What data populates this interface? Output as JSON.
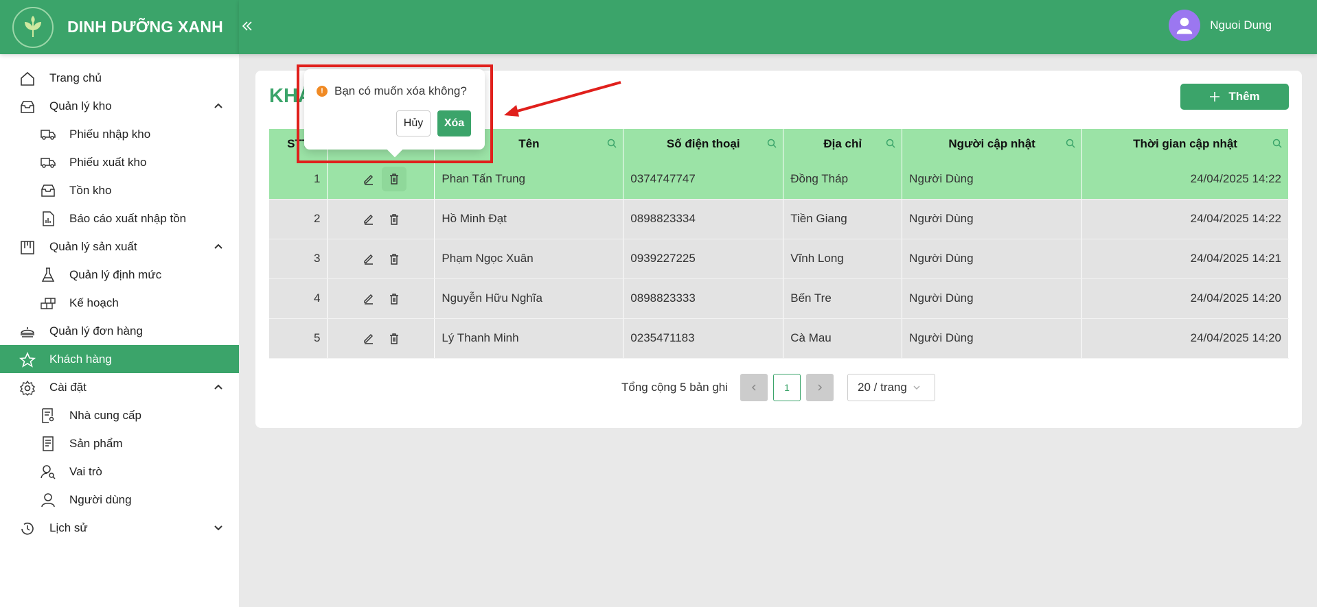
{
  "brand": {
    "title": "DINH DƯỠNG XANH"
  },
  "header": {
    "user_name": "Nguoi Dung"
  },
  "sidebar": {
    "items": [
      {
        "label": "Trang chủ"
      },
      {
        "label": "Quản lý kho"
      },
      {
        "label": "Phiếu nhập kho"
      },
      {
        "label": "Phiếu xuất kho"
      },
      {
        "label": "Tồn kho"
      },
      {
        "label": "Báo cáo xuất nhập tồn"
      },
      {
        "label": "Quản lý sản xuất"
      },
      {
        "label": "Quản lý định mức"
      },
      {
        "label": "Kế hoạch"
      },
      {
        "label": "Quản lý đơn hàng"
      },
      {
        "label": "Khách hàng"
      },
      {
        "label": "Cài đặt"
      },
      {
        "label": "Nhà cung cấp"
      },
      {
        "label": "Sản phẩm"
      },
      {
        "label": "Vai trò"
      },
      {
        "label": "Người dùng"
      },
      {
        "label": "Lịch sử"
      }
    ]
  },
  "page": {
    "title": "KHÁCH HÀNG",
    "add_label": "Thêm"
  },
  "table": {
    "headers": [
      "STT",
      "",
      "Tên",
      "Số điện thoại",
      "Địa chỉ",
      "Người cập nhật",
      "Thời gian cập nhật"
    ],
    "rows": [
      {
        "stt": "1",
        "name": "Phan Tấn Trung",
        "phone": "0374747747",
        "address": "Đồng Tháp",
        "updated_by": "Người Dùng",
        "updated_at": "24/04/2025 14:22"
      },
      {
        "stt": "2",
        "name": "Hồ Minh Đạt",
        "phone": "0898823334",
        "address": "Tiền Giang",
        "updated_by": "Người Dùng",
        "updated_at": "24/04/2025 14:22"
      },
      {
        "stt": "3",
        "name": "Phạm Ngọc Xuân",
        "phone": "0939227225",
        "address": "Vĩnh Long",
        "updated_by": "Người Dùng",
        "updated_at": "24/04/2025 14:21"
      },
      {
        "stt": "4",
        "name": "Nguyễn Hữu Nghĩa",
        "phone": "0898823333",
        "address": "Bến Tre",
        "updated_by": "Người Dùng",
        "updated_at": "24/04/2025 14:20"
      },
      {
        "stt": "5",
        "name": "Lý Thanh Minh",
        "phone": "0235471183",
        "address": "Cà Mau",
        "updated_by": "Người Dùng",
        "updated_at": "24/04/2025 14:20"
      }
    ]
  },
  "pagination": {
    "total_text": "Tổng cộng 5 bản ghi",
    "current_page": "1",
    "page_size": "20 / trang"
  },
  "popconfirm": {
    "message": "Bạn có muốn xóa không?",
    "cancel_label": "Hủy",
    "ok_label": "Xóa"
  },
  "colors": {
    "primary": "#3ba46a",
    "header_row": "#9be3a6",
    "row_bg": "#e3e3e3",
    "annotation": "#e0201c"
  }
}
